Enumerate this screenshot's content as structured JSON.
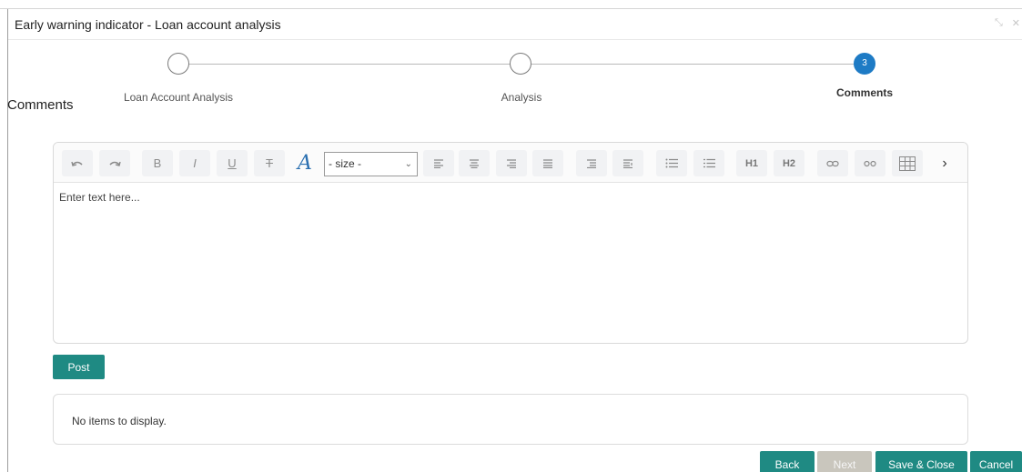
{
  "window": {
    "title": "Early warning indicator - Loan account analysis"
  },
  "stepper": {
    "steps": [
      {
        "label": "Loan Account Analysis",
        "number": "",
        "state": "incomplete"
      },
      {
        "label": "Analysis",
        "number": "",
        "state": "incomplete"
      },
      {
        "label": "Comments",
        "number": "3",
        "state": "active"
      }
    ]
  },
  "section": {
    "title": "Comments"
  },
  "editor": {
    "placeholder": "Enter text here...",
    "size_select": {
      "value": "- size -"
    },
    "toolbar": {
      "h1_label": "H1",
      "h2_label": "H2",
      "bold_label": "B",
      "italic_label": "I",
      "underline_label": "U",
      "strike_label": "T",
      "font_color_label": "A"
    }
  },
  "actions": {
    "post_label": "Post"
  },
  "items": {
    "empty_text": "No items to display."
  },
  "footer": {
    "back_label": "Back",
    "next_label": "Next",
    "save_close_label": "Save & Close",
    "cancel_label": "Cancel"
  },
  "colors": {
    "accent": "#1f8a83",
    "active_step": "#1e7bc5",
    "disabled": "#c9c6bd"
  }
}
